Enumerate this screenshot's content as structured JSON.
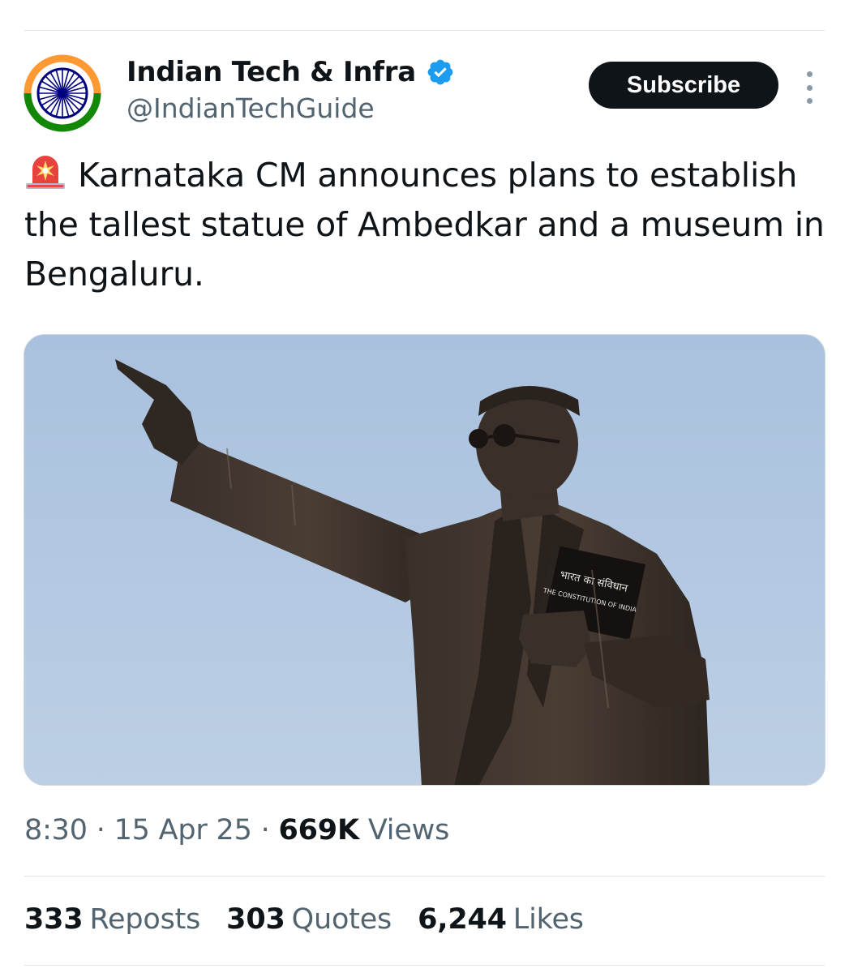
{
  "author": {
    "display_name": "Indian Tech & Infra",
    "handle": "@IndianTechGuide",
    "verified": true,
    "avatar_icon": "ashoka-chakra-avatar"
  },
  "actions": {
    "subscribe_label": "Subscribe",
    "more_icon": "more-vertical-icon"
  },
  "tweet": {
    "emoji_icon": "police-siren-icon",
    "text": "Karnataka CM announces plans to establish the tallest statue of Ambedkar and a museum in Bengaluru."
  },
  "media": {
    "book_line1": "भारत का संविधान",
    "book_line2": "THE CONSTITUTION OF INDIA"
  },
  "meta": {
    "time": "8:30",
    "separator": "·",
    "date": "15 Apr 25",
    "views_count": "669K",
    "views_label": "Views"
  },
  "stats": {
    "reposts_count": "333",
    "reposts_label": "Reposts",
    "quotes_count": "303",
    "quotes_label": "Quotes",
    "likes_count": "6,244",
    "likes_label": "Likes"
  },
  "colors": {
    "text_primary": "#0f1419",
    "text_secondary": "#536471",
    "verified_blue": "#1d9bf0",
    "saffron": "#ff9933",
    "india_green": "#138808",
    "chakra_navy": "#000080"
  }
}
